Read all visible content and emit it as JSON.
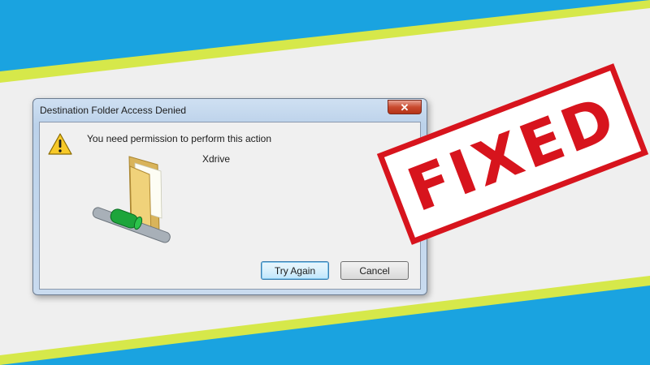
{
  "dialog": {
    "title": "Destination Folder Access Denied",
    "close_glyph": "✕",
    "message": "You need permission to perform this action",
    "item_name": "Xdrive",
    "icons": [
      "warning-icon",
      "folder-network-icon",
      "close-icon"
    ],
    "buttons": {
      "try_again": "Try Again",
      "cancel": "Cancel"
    }
  },
  "stamp": {
    "text": "FIXED",
    "color": "#d7141d"
  },
  "colors": {
    "background_blue": "#1aa3e0",
    "band_light": "#efefef",
    "band_lime": "#d6e84a"
  }
}
